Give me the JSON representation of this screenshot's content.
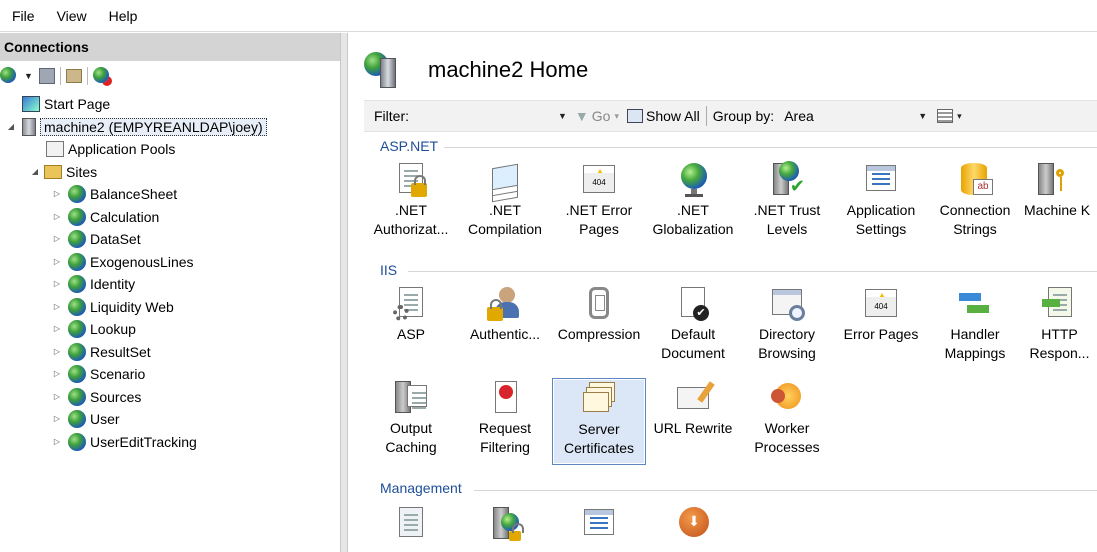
{
  "menu": {
    "file": "File",
    "view": "View",
    "help": "Help"
  },
  "connections": {
    "title": "Connections",
    "tree": {
      "start_page": "Start Page",
      "server": "machine2 (EMPYREANLDAP\\joey)",
      "app_pools": "Application Pools",
      "sites": "Sites",
      "site_items": [
        "BalanceSheet",
        "Calculation",
        "DataSet",
        "ExogenousLines",
        "Identity",
        "Liquidity Web",
        "Lookup",
        "ResultSet",
        "Scenario",
        "Sources",
        "User",
        "UserEditTracking"
      ]
    }
  },
  "home": {
    "title": "machine2 Home",
    "filter_label": "Filter:",
    "go_label": "Go",
    "show_all_label": "Show All",
    "group_by_label": "Group by:",
    "group_by_value": "Area"
  },
  "sections": {
    "aspnet": {
      "title": "ASP.NET",
      "items": [
        {
          "line1": ".NET",
          "line2": "Authorizat...",
          "icon": "authorization-lock-icon"
        },
        {
          "line1": ".NET",
          "line2": "Compilation",
          "icon": "compilation-icon"
        },
        {
          "line1": ".NET Error",
          "line2": "Pages",
          "icon": "error-404-icon"
        },
        {
          "line1": ".NET",
          "line2": "Globalization",
          "icon": "globe-icon"
        },
        {
          "line1": ".NET Trust",
          "line2": "Levels",
          "icon": "trust-check-icon"
        },
        {
          "line1": "Application",
          "line2": "Settings",
          "icon": "settings-list-icon"
        },
        {
          "line1": "Connection",
          "line2": "Strings",
          "icon": "database-ab-icon"
        },
        {
          "line1": "Machine K",
          "line2": "",
          "icon": "machine-key-icon"
        }
      ]
    },
    "iis": {
      "title": "IIS",
      "items": [
        {
          "line1": "ASP",
          "line2": "",
          "icon": "asp-gear-icon"
        },
        {
          "line1": "Authentic...",
          "line2": "",
          "icon": "authentication-user-icon"
        },
        {
          "line1": "Compression",
          "line2": "",
          "icon": "compression-clamp-icon"
        },
        {
          "line1": "Default",
          "line2": "Document",
          "icon": "default-document-icon"
        },
        {
          "line1": "Directory",
          "line2": "Browsing",
          "icon": "directory-browsing-icon"
        },
        {
          "line1": "Error Pages",
          "line2": "",
          "icon": "error-404-icon"
        },
        {
          "line1": "Handler",
          "line2": "Mappings",
          "icon": "handler-arrows-icon"
        },
        {
          "line1": "HTTP",
          "line2": "Respon...",
          "icon": "http-response-icon"
        },
        {
          "line1": "Output",
          "line2": "Caching",
          "icon": "output-caching-icon"
        },
        {
          "line1": "Request",
          "line2": "Filtering",
          "icon": "request-filtering-icon"
        },
        {
          "line1": "Server",
          "line2": "Certificates",
          "icon": "certificates-icon"
        },
        {
          "line1": "URL Rewrite",
          "line2": "",
          "icon": "url-rewrite-icon"
        },
        {
          "line1": "Worker",
          "line2": "Processes",
          "icon": "worker-processes-icon"
        }
      ]
    },
    "management": {
      "title": "Management"
    }
  }
}
